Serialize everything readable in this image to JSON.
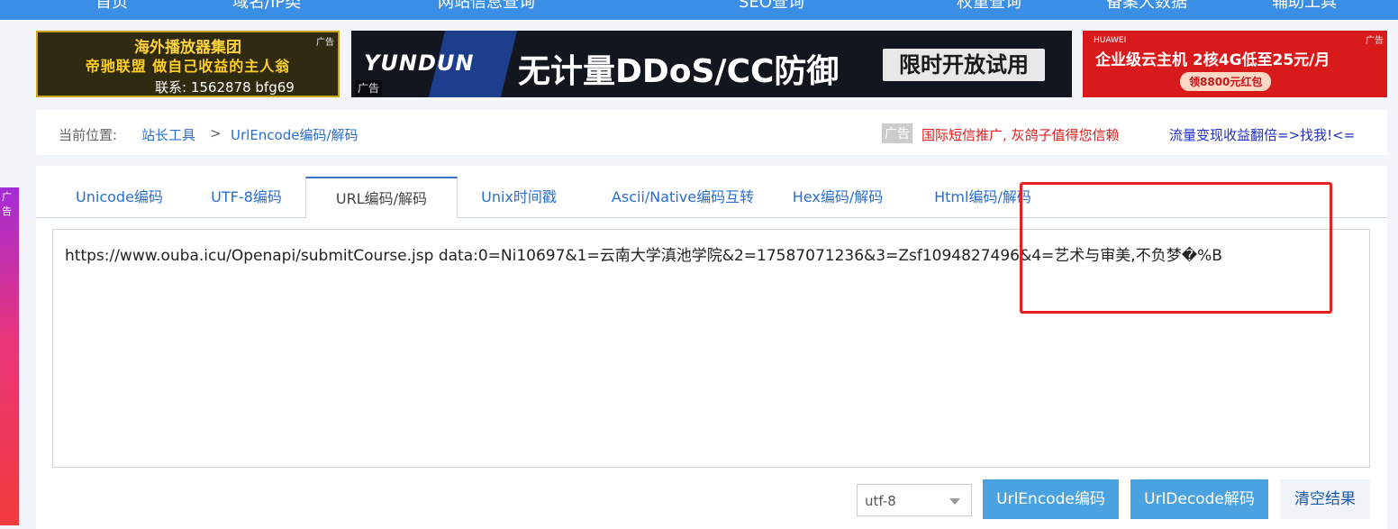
{
  "topnav": {
    "items": [
      "首页",
      "域名/IP类",
      "网站信息查询",
      "SEO查询",
      "权重查询",
      "备案大数据",
      "辅助工具"
    ]
  },
  "ads": {
    "ad1": {
      "title": "海外播放器集团",
      "slogan": "帝驰联盟 做自己收益的主人翁",
      "contact": "联系: 1562878  bfg69",
      "tag": "广告"
    },
    "ad2": {
      "brand": "YUNDUN",
      "headline": "无计量DDoS/CC防御",
      "cta": "限时开放试用",
      "tag": "广告"
    },
    "ad3": {
      "brand": "HUAWEI",
      "headline": "企业级云主机 2核4G低至25元/月",
      "pill": "领8800元红包",
      "tag": "广告"
    },
    "side_tag": "广告"
  },
  "breadcrumb": {
    "label": "当前位置:",
    "root": "站长工具",
    "separator": ">",
    "current": "UrlEncode编码/解码",
    "ad_badge": "广告",
    "ad_red": "国际短信推广, 灰鸽子值得您信赖",
    "ad_blue": "流量变现收益翻倍=>找我!<="
  },
  "tabs": [
    {
      "label": "Unicode编码",
      "active": false
    },
    {
      "label": "UTF-8编码",
      "active": false
    },
    {
      "label": "URL编码/解码",
      "active": true
    },
    {
      "label": "Unix时间戳",
      "active": false
    },
    {
      "label": "Ascii/Native编码互转",
      "active": false
    },
    {
      "label": "Hex编码/解码",
      "active": false
    },
    {
      "label": "Html编码/解码",
      "active": false
    }
  ],
  "editor": {
    "value": "https://www.ouba.icu/Openapi/submitCourse.jsp data:0=Ni10697&1=云南大学滇池学院&2=17587071236&3=Zsf1094827496&4=艺术与审美,不负梦�%B"
  },
  "controls": {
    "charset": "utf-8",
    "encode_label": "UrlEncode编码",
    "decode_label": "UrlDecode解码",
    "clear_label": "清空结果"
  },
  "colors": {
    "nav_blue": "#3a8ee6",
    "link_blue": "#2a6ecf",
    "button_blue": "#4aa3e0",
    "annotation_red": "#ea1f1f"
  }
}
